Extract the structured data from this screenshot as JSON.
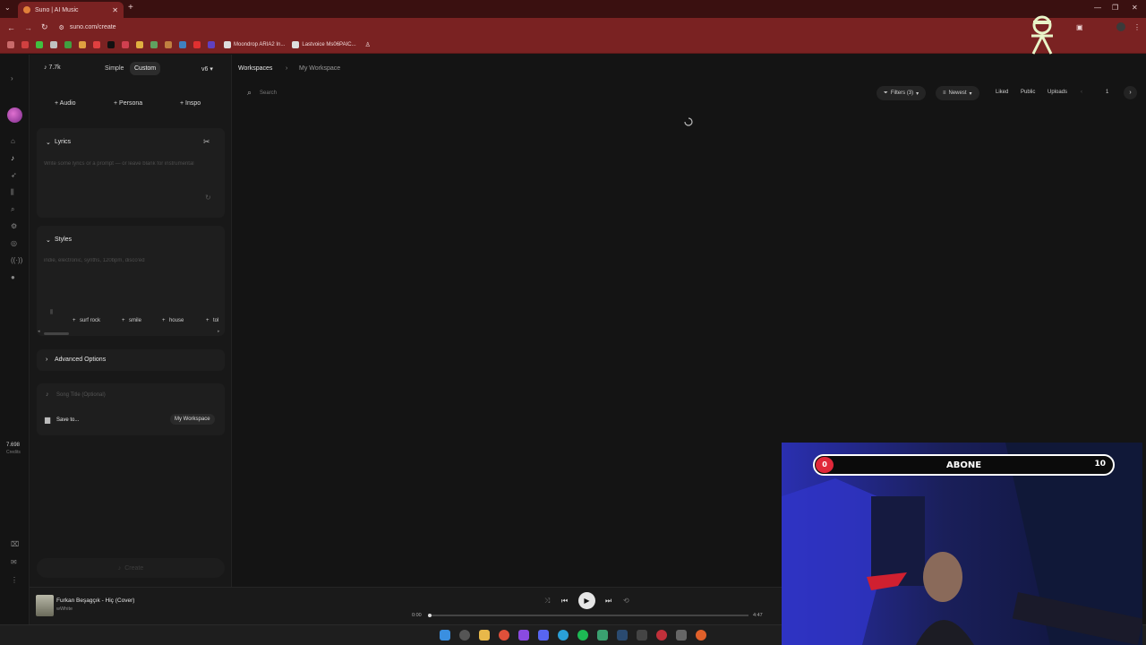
{
  "browser": {
    "tab_title": "Suno | AI Music",
    "url": "suno.com/create",
    "bookmarks": [
      "Moondrop ARIA2 In...",
      "Lastvoice Ms06PAIC..."
    ]
  },
  "panel": {
    "credits_badge": "7.7k",
    "mode_simple": "Simple",
    "mode_custom": "Custom",
    "version": "v6",
    "add_audio": "Audio",
    "add_persona": "Persona",
    "add_inspo": "Inspo",
    "lyrics_title": "Lyrics",
    "lyrics_placeholder": "Write some lyrics or a prompt — or leave blank for instrumental",
    "styles_title": "Styles",
    "styles_placeholder": "indie, electronic, synths, 120bpm, disco'ed",
    "style_tags": [
      "surf rock",
      "smile",
      "house",
      "tol"
    ],
    "advanced_options": "Advanced Options",
    "song_title_placeholder": "Song Title (Optional)",
    "save_to": "Save to...",
    "workspace_button": "My Workspace",
    "create_button": "Create"
  },
  "rail": {
    "credits_count": "7.698",
    "credits_label": "Credits"
  },
  "main": {
    "breadcrumb_root": "Workspaces",
    "breadcrumb_current": "My Workspace",
    "search_placeholder": "Search",
    "filters_label": "Filters (3)",
    "sort_label": "Newest",
    "liked": "Liked",
    "public": "Public",
    "uploads": "Uploads",
    "page_number": "1"
  },
  "player": {
    "track_title": "Furkan Beşagçık - Hiç (Cover)",
    "artist": "wWhite",
    "time_current": "0:00",
    "time_total": "4:47",
    "progress": 0.0
  },
  "overlay": {
    "subscribe_label": "ABONE",
    "current": "0",
    "goal": "10"
  },
  "colors": {
    "browser_theme": "#7a2222",
    "subscribe_dot": "#e0283a",
    "background": "#141414"
  }
}
